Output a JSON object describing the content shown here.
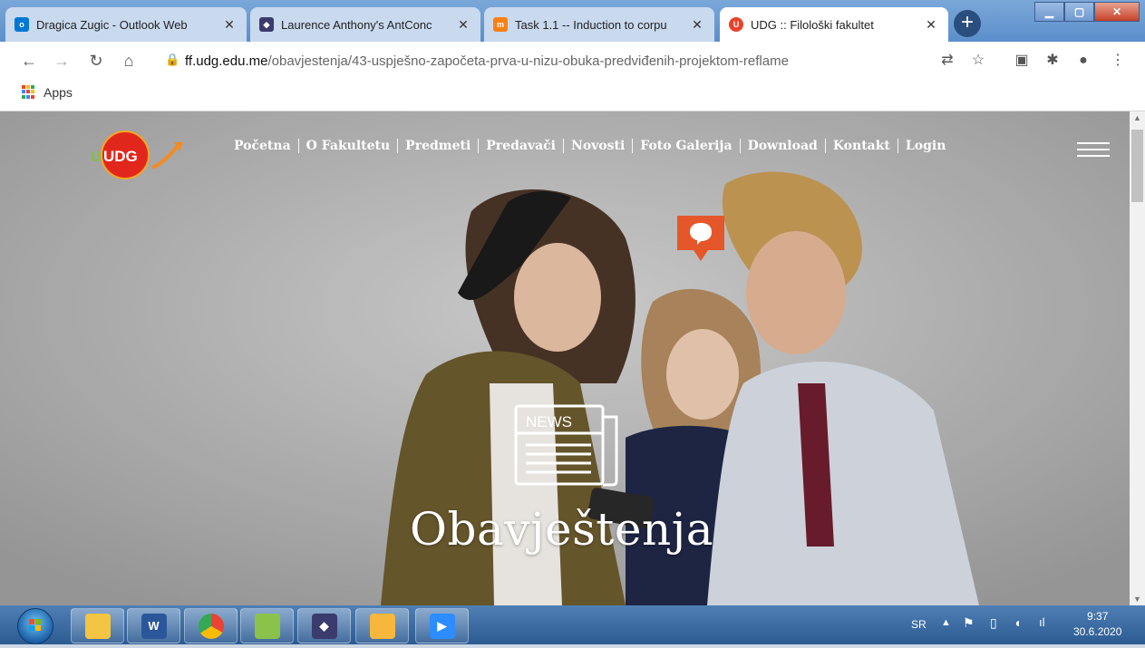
{
  "browser": {
    "tabs": [
      {
        "title": "Dragica Zugic - Outlook Web",
        "icon": "outlook-icon",
        "color": "#0078d4"
      },
      {
        "title": "Laurence Anthony's AntConc",
        "icon": "antconc-icon",
        "color": "#3b3b6d"
      },
      {
        "title": "Task 1.1 -- Induction to corpu",
        "icon": "moodle-icon",
        "color": "#f98012"
      },
      {
        "title": "UDG :: Filološki fakultet",
        "icon": "udg-icon",
        "color": "#e8422a",
        "active": true
      }
    ],
    "url_host": "ff.udg.edu.me",
    "url_path": "/obavjestenja/43-uspješno-započeta-prva-u-nizu-obuka-predviđenih-projektom-reflame",
    "bookmarks_apps_label": "Apps"
  },
  "site": {
    "logo_text": "UDG",
    "nav": [
      "Početna",
      "O Fakultetu",
      "Predmeti",
      "Predavači",
      "Novosti",
      "Foto Galerija",
      "Download",
      "Kontakt",
      "Login"
    ],
    "news_icon_label": "NEWS",
    "hero_title": "Obavještenja",
    "accent_color": "#e5572a"
  },
  "taskbar": {
    "language": "SR",
    "time": "9:37",
    "date": "30.6.2020"
  }
}
